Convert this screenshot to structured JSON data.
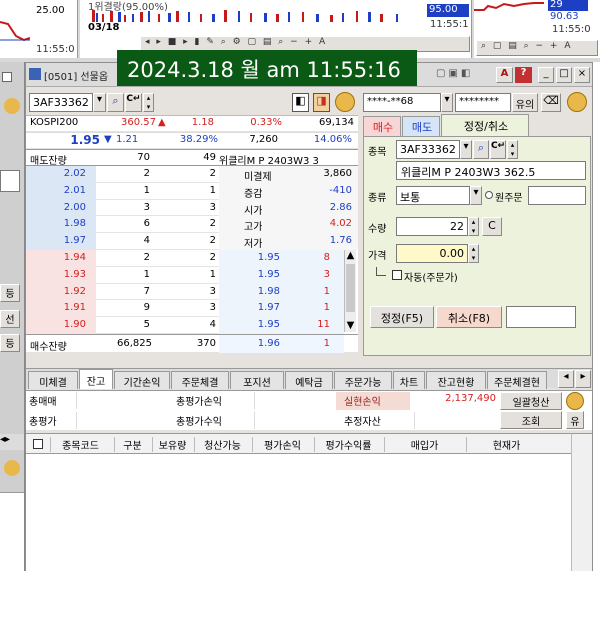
{
  "timestamp_banner": "2024.3.18 월 am 11:55:16",
  "bg_windows": {
    "left_chart_value": "25.00",
    "left_chart_time": "11:55:0",
    "mid_chart_title": "1위결랑(95.00%)",
    "mid_chart_date": "03/18",
    "mid_chart_value": "95.00",
    "mid_chart_time": "11:55:1",
    "right_chart_value_top": "29",
    "right_chart_value": "90.63",
    "right_chart_time": "11:55:0",
    "left_side_buttons": [
      "등",
      "선",
      "등"
    ]
  },
  "window": {
    "title": "[0501] 선물옵",
    "title_buttons": [
      "A",
      "?",
      "_",
      "□",
      "×"
    ]
  },
  "left": {
    "code": "3AF33362",
    "index_name": "KOSPI200",
    "index_value": "360.57",
    "index_arrow": "▲",
    "index_change": "1.18",
    "index_rate": "0.33%",
    "index_volume": "69,134",
    "price": "1.95",
    "price_arrow": "▼",
    "price_change": "1.21",
    "price_rate": "38.29%",
    "volume": "7,260",
    "volume_rate": "14.06%",
    "header": {
      "ask_label": "매도잔량",
      "ask_count": "70",
      "ask_qty": "49",
      "product": "위클리M P 2403W3 3"
    },
    "asks": [
      {
        "price": "2.02",
        "qty": "2",
        "cnt": "2",
        "label": "미결제",
        "value": "3,860",
        "value_color": "#000000"
      },
      {
        "price": "2.01",
        "qty": "1",
        "cnt": "1",
        "label": "증감",
        "value": "-410",
        "value_color": "#1d3fc4"
      },
      {
        "price": "2.00",
        "qty": "3",
        "cnt": "3",
        "label": "시가",
        "value": "2.86",
        "value_color": "#1d3fc4"
      },
      {
        "price": "1.98",
        "qty": "6",
        "cnt": "2",
        "label": "고가",
        "value": "4.02",
        "value_color": "#d42020"
      },
      {
        "price": "1.97",
        "qty": "4",
        "cnt": "2",
        "label": "저가",
        "value": "1.76",
        "value_color": "#1d3fc4"
      }
    ],
    "bids": [
      {
        "price": "1.94",
        "qty": "2",
        "cnt": "2",
        "tprice": "1.95",
        "tqty": "8"
      },
      {
        "price": "1.93",
        "qty": "1",
        "cnt": "1",
        "tprice": "1.95",
        "tqty": "3"
      },
      {
        "price": "1.92",
        "qty": "7",
        "cnt": "3",
        "tprice": "1.98",
        "tqty": "1"
      },
      {
        "price": "1.91",
        "qty": "9",
        "cnt": "3",
        "tprice": "1.97",
        "tqty": "1"
      },
      {
        "price": "1.90",
        "qty": "5",
        "cnt": "4",
        "tprice": "1.95",
        "tqty": "11"
      }
    ],
    "footer": {
      "label": "매수잔량",
      "qty": "66,825",
      "cnt": "370",
      "tprice": "1.96",
      "tqty": "1"
    }
  },
  "right": {
    "account": "****-**68",
    "password": "********",
    "account_btn": "유의",
    "tabs": [
      "매수",
      "매도",
      "정정/취소"
    ],
    "code_label": "종목",
    "code": "3AF33362",
    "product_name": "위클리M P 2403W3 362.5",
    "type_label": "종류",
    "type_value": "보통",
    "orig_label": "원주문",
    "qty_label": "수량",
    "qty_value": "22",
    "qty_btn": "C",
    "price_label": "가격",
    "price_value": "0.00",
    "auto_label": "자동(주문가)",
    "modify_btn": "정정(F5)",
    "cancel_btn": "취소(F8)"
  },
  "bottom": {
    "tabs": [
      "미체결",
      "잔고",
      "기간손익",
      "주문체결",
      "포지션",
      "예탁금",
      "주문가능",
      "차트",
      "잔고현황",
      "주문체결현"
    ],
    "active_tab": 1,
    "summary": {
      "row1": [
        "총매매",
        "",
        "총평가손익",
        "",
        "실현손익",
        "2,137,490",
        "일괄청산"
      ],
      "row2": [
        "총평가",
        "",
        "총평가수익",
        "",
        "추정자산",
        "",
        "조회",
        "유"
      ]
    },
    "columns": [
      "종목코드",
      "구분",
      "보유량",
      "청산가능",
      "평가손익",
      "평가수익률",
      "매입가",
      "현재가"
    ]
  }
}
